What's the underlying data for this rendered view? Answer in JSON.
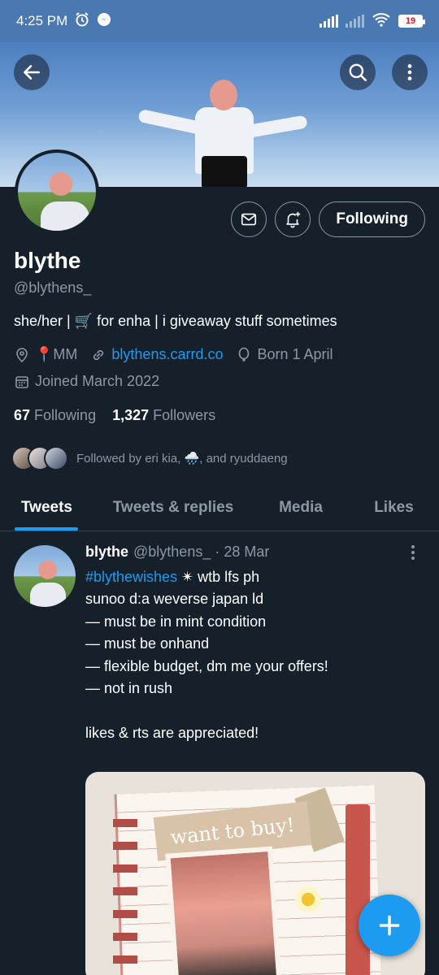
{
  "status_bar": {
    "time": "4:25 PM",
    "battery": "19"
  },
  "profile": {
    "name": "blythe",
    "handle": "@blythens_",
    "bio": "she/her | 🛒 for enha | i giveaway stuff sometimes",
    "location": "📍MM",
    "website": "blythens.carrd.co",
    "birthday": "Born 1 April",
    "joined": "Joined March 2022",
    "following_count": "67",
    "following_label": "Following",
    "followers_count": "1,327",
    "followers_label": "Followers",
    "followed_by": "Followed by eri kia, 🌧️, and ryuddaeng",
    "follow_button": "Following"
  },
  "tabs": [
    {
      "label": "Tweets"
    },
    {
      "label": "Tweets & replies"
    },
    {
      "label": "Media"
    },
    {
      "label": "Likes"
    }
  ],
  "tweet": {
    "name": "blythe",
    "meta": "@blythens_ · 28 Mar",
    "hashtag": "#blythewishes",
    "body_first": " ✴ wtb lfs ph",
    "body": "\nsunoo d:a weverse japan ld\n— must be in mint condition\n— must be onhand\n— flexible budget, dm me your offers!\n— not in rush\n\nlikes & rts are appreciated!",
    "media_text": "want to buy!"
  },
  "colors": {
    "background": "#15202b",
    "accent": "#1d9bf0",
    "secondary_text": "#8b98a5"
  }
}
